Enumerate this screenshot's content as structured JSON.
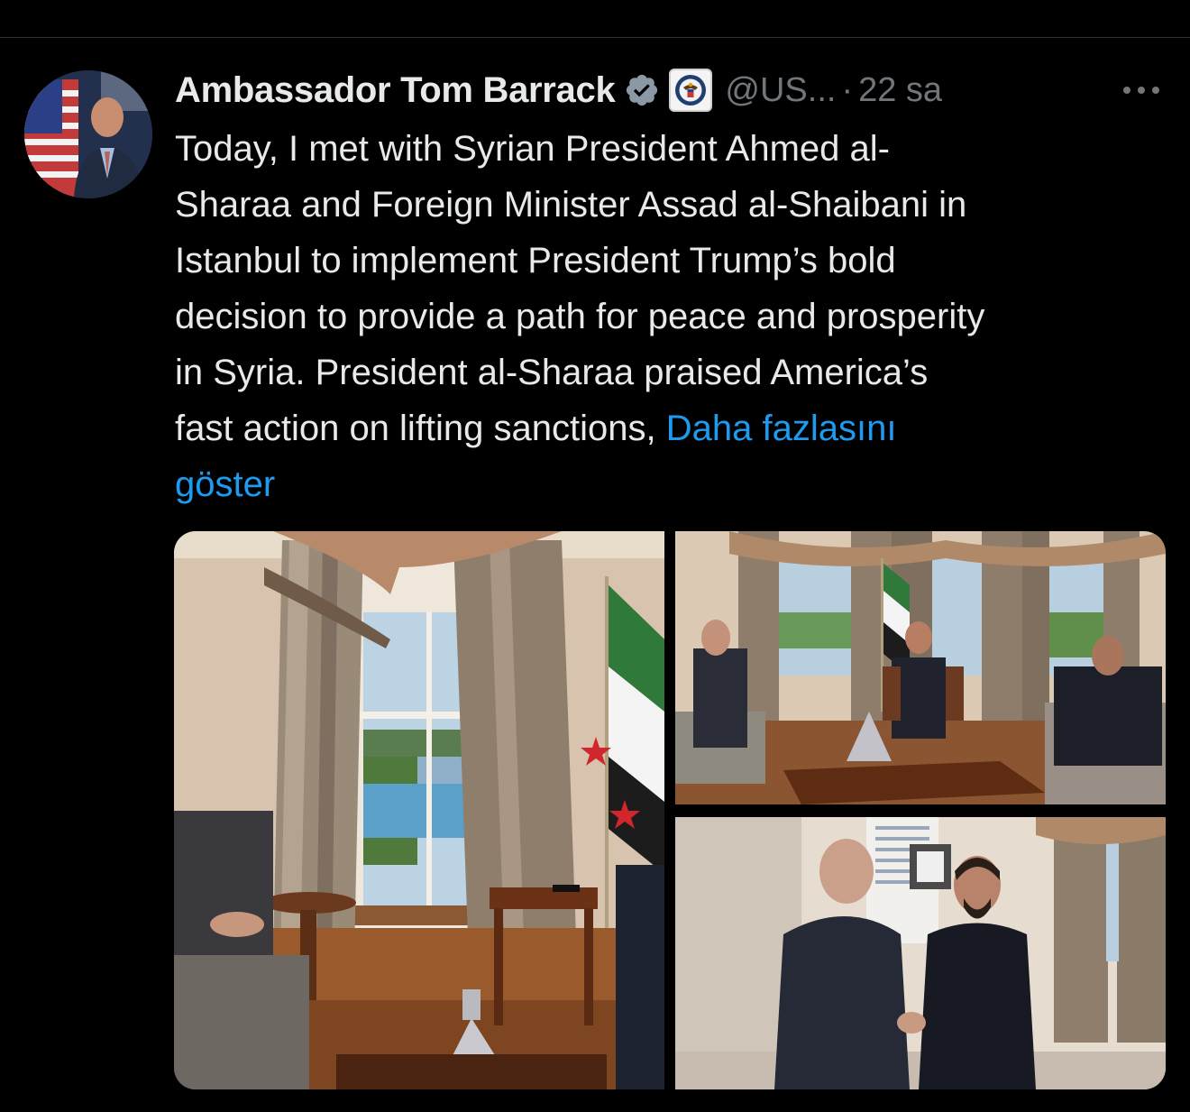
{
  "tweet": {
    "author_name": "Ambassador Tom Barrack",
    "handle": "@US...",
    "separator": "·",
    "time": "22 sa",
    "text_lines": [
      "Today, I met with Syrian President Ahmed al-",
      "Sharaa and Foreign Minister Assad al-Shaibani in",
      "Istanbul to implement President Trump’s bold",
      "decision to provide a path for peace and prosperity",
      "in Syria.  President al-Sharaa praised America’s",
      "fast action on lifting sanctions, "
    ],
    "show_more_part1": "Daha fazlasını",
    "show_more_part2": "göster"
  },
  "icons": {
    "verified": "verified-badge-icon",
    "affiliation": "state-department-seal-icon",
    "more": "more-options-icon"
  },
  "colors": {
    "background": "#000000",
    "text": "#e7e9ea",
    "muted": "#71767b",
    "link": "#1d9bf0"
  }
}
